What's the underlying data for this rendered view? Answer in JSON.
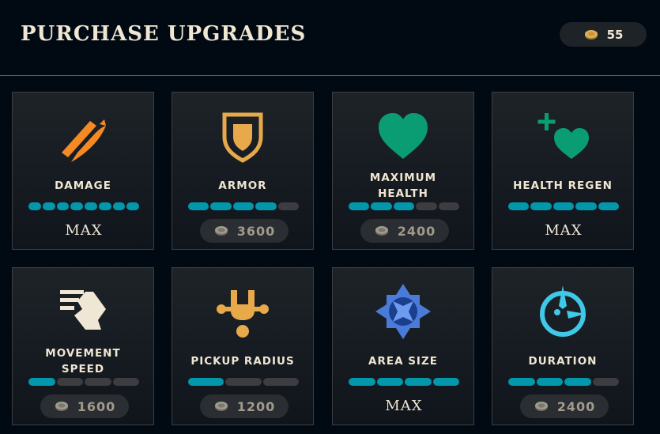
{
  "header": {
    "title": "PURCHASE UPGRADES",
    "currency": "55",
    "currency_icon": "coin-icon"
  },
  "colors": {
    "accent_bar": "#0397ab",
    "empty_bar": "#3c3c41",
    "gold": "#f0e6d2"
  },
  "upgrades": [
    {
      "name": "DAMAGE",
      "icon": "sword-slash-icon",
      "level": 8,
      "max_level": 8,
      "maxed": true,
      "max_label": "MAX",
      "cost": null
    },
    {
      "name": "ARMOR",
      "icon": "shield-icon",
      "level": 4,
      "max_level": 5,
      "maxed": false,
      "max_label": "",
      "cost": "3600"
    },
    {
      "name": "MAXIMUM\nHEALTH",
      "icon": "heart-icon",
      "level": 3,
      "max_level": 5,
      "maxed": false,
      "max_label": "",
      "cost": "2400"
    },
    {
      "name": "HEALTH REGEN",
      "icon": "heart-plus-icon",
      "level": 5,
      "max_level": 5,
      "maxed": true,
      "max_label": "MAX",
      "cost": null
    },
    {
      "name": "MOVEMENT\nSPEED",
      "icon": "speed-boot-icon",
      "level": 1,
      "max_level": 4,
      "maxed": false,
      "max_label": "",
      "cost": "1600"
    },
    {
      "name": "PICKUP RADIUS",
      "icon": "magnet-icon",
      "level": 1,
      "max_level": 3,
      "maxed": false,
      "max_label": "",
      "cost": "1200"
    },
    {
      "name": "AREA SIZE",
      "icon": "compass-star-icon",
      "level": 4,
      "max_level": 4,
      "maxed": true,
      "max_label": "MAX",
      "cost": null
    },
    {
      "name": "DURATION",
      "icon": "timer-icon",
      "level": 3,
      "max_level": 4,
      "maxed": false,
      "max_label": "",
      "cost": "2400"
    }
  ]
}
